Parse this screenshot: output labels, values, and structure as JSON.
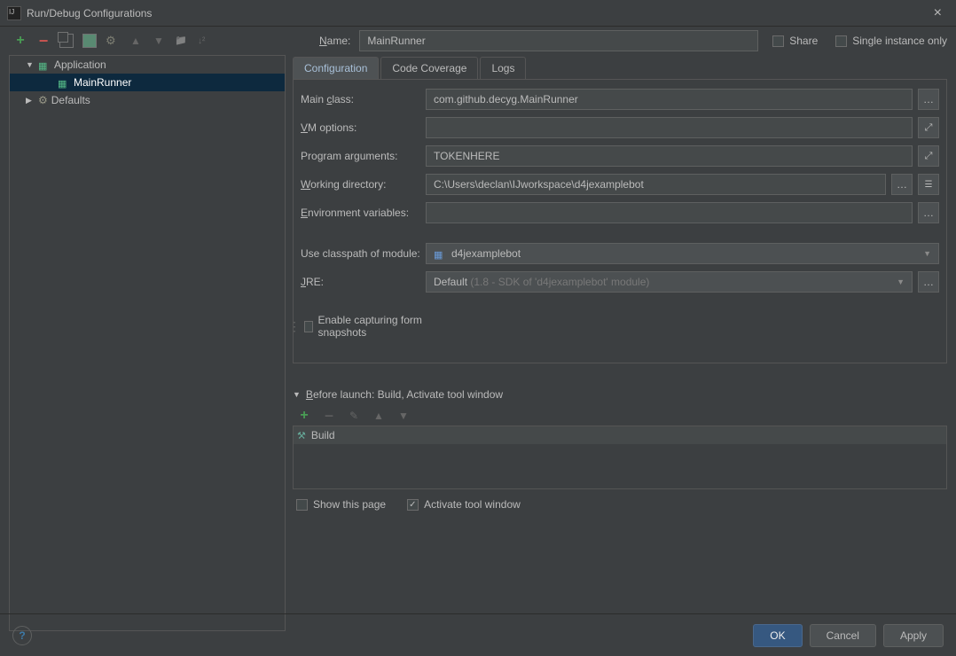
{
  "window": {
    "title": "Run/Debug Configurations"
  },
  "name_field": {
    "label_prefix": "N",
    "label_rest": "ame:",
    "value": "MainRunner"
  },
  "checks": {
    "share": "Share",
    "single": "Single instance only"
  },
  "tree": {
    "application": "Application",
    "config": "MainRunner",
    "defaults": "Defaults"
  },
  "tabs": {
    "configuration": "Configuration",
    "coverage": "Code Coverage",
    "logs": "Logs"
  },
  "form": {
    "main_class": {
      "label_pre": "Main ",
      "u": "c",
      "label_post": "lass:",
      "value": "com.github.decyg.MainRunner"
    },
    "vm_options": {
      "u": "V",
      "label_post": "M options:",
      "value": ""
    },
    "program_args": {
      "label_pre": "Pro",
      "u": "g",
      "label_post": "ram arguments:",
      "value": "TOKENHERE"
    },
    "working_dir": {
      "u": "W",
      "label_post": "orking directory:",
      "value": "C:\\Users\\declan\\IJworkspace\\d4jexamplebot"
    },
    "env_vars": {
      "u": "E",
      "label_post": "nvironment variables:",
      "value": ""
    },
    "module": {
      "label": "Use classpath of module:",
      "value": "d4jexamplebot"
    },
    "jre": {
      "u": "J",
      "label_post": "RE:",
      "value": "Default",
      "hint": " (1.8 - SDK of 'd4jexamplebot' module)"
    },
    "snapshots": "Enable capturing form snapshots"
  },
  "before_launch": {
    "header_u": "B",
    "header_rest": "efore launch: Build, Activate tool window",
    "item": "Build",
    "show_page": "Show this page",
    "activate": "Activate tool window"
  },
  "footer": {
    "ok": "OK",
    "cancel": "Cancel",
    "apply": "Apply"
  }
}
